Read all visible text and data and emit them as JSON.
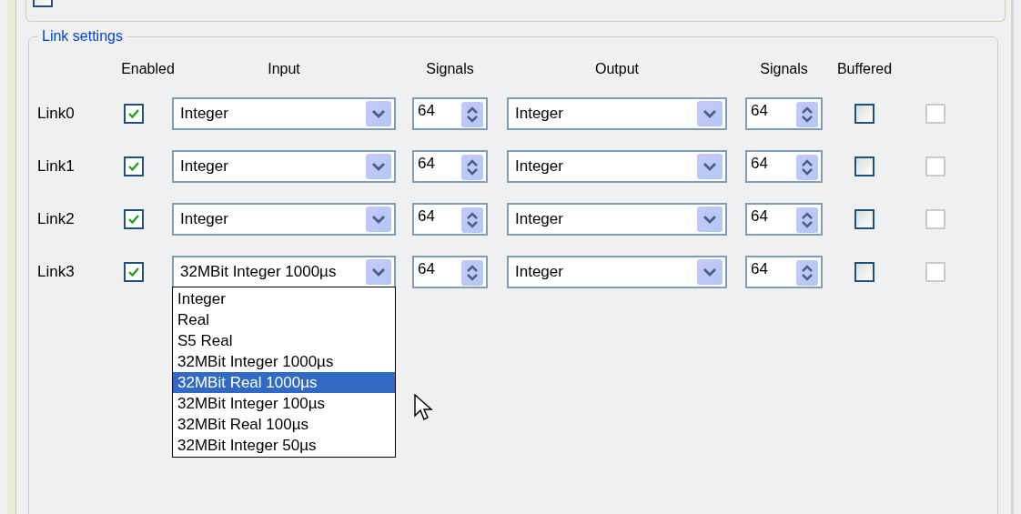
{
  "top_group": {
    "checkbox_checked": false
  },
  "link_settings": {
    "title": "Link settings",
    "columns": [
      "Enabled",
      "Input",
      "Signals",
      "Output",
      "Signals",
      "Buffered"
    ],
    "links": [
      {
        "name": "Link0",
        "enabled": true,
        "input": "Integer",
        "input_signals": "64",
        "output": "Integer",
        "output_signals": "64",
        "buffered": false,
        "extra": {
          "checked": false,
          "disabled": true
        },
        "open": false
      },
      {
        "name": "Link1",
        "enabled": true,
        "input": "Integer",
        "input_signals": "64",
        "output": "Integer",
        "output_signals": "64",
        "buffered": false,
        "extra": {
          "checked": false,
          "disabled": true
        },
        "open": false
      },
      {
        "name": "Link2",
        "enabled": true,
        "input": "Integer",
        "input_signals": "64",
        "output": "Integer",
        "output_signals": "64",
        "buffered": false,
        "extra": {
          "checked": false,
          "disabled": true
        },
        "open": false
      },
      {
        "name": "Link3",
        "enabled": true,
        "input": "32MBit Integer 1000µs",
        "input_signals": "64",
        "output": "Integer",
        "output_signals": "64",
        "buffered": false,
        "extra": {
          "checked": false,
          "disabled": true
        },
        "open": true,
        "options": [
          {
            "label": "Integer",
            "selected": false
          },
          {
            "label": "Real",
            "selected": false
          },
          {
            "label": "S5 Real",
            "selected": false
          },
          {
            "label": "32MBit Integer 1000µs",
            "selected": false
          },
          {
            "label": "32MBit Real 1000µs",
            "selected": true
          },
          {
            "label": "32MBit Integer 100µs",
            "selected": false
          },
          {
            "label": "32MBit Real 100µs",
            "selected": false
          },
          {
            "label": "32MBit Integer 50µs",
            "selected": false
          }
        ]
      }
    ]
  }
}
